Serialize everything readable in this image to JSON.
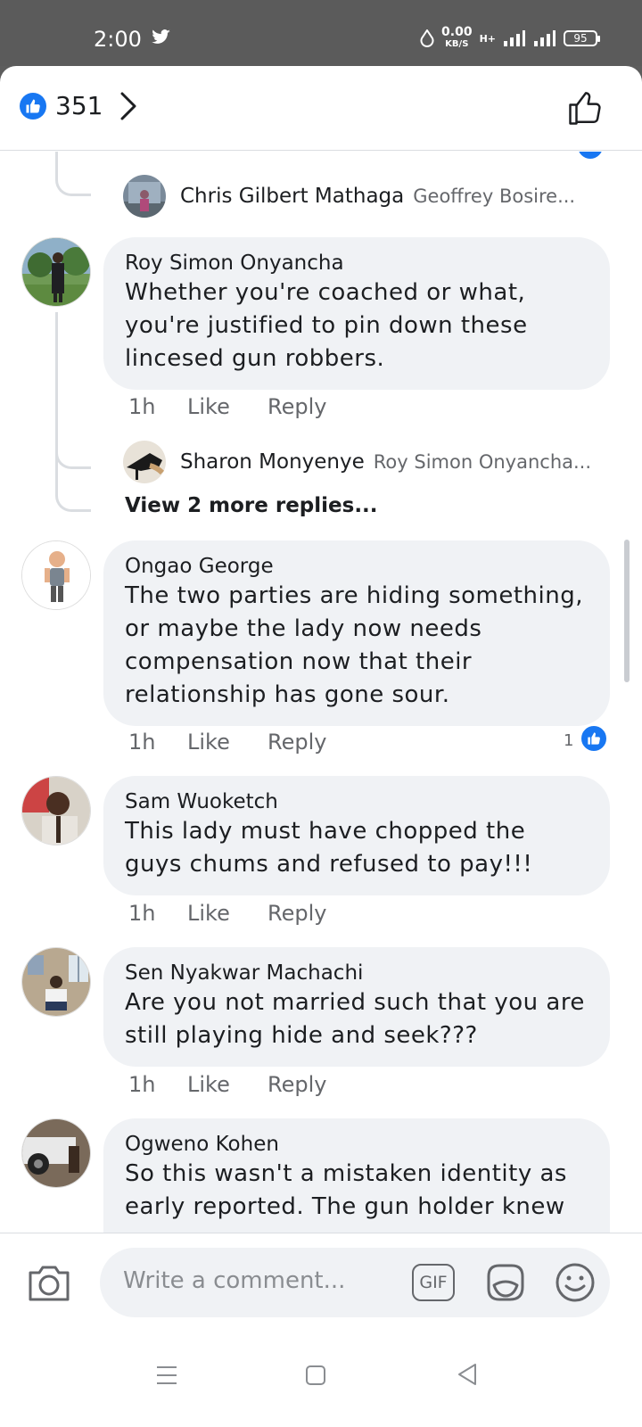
{
  "status_bar": {
    "time": "2:00",
    "speed_value": "0.00",
    "speed_unit": "KB/S",
    "network": "H+",
    "battery": "95"
  },
  "header": {
    "reaction_count": "351"
  },
  "comments": [
    {
      "author": "Roy Simon Onyancha",
      "text": "Whether you're coached or what, you're justified to pin down these lincesed gun robbers.",
      "time": "1h",
      "like": "Like",
      "reply": "Reply"
    },
    {
      "author": "Ongao George",
      "text": "The two parties are hiding something, or maybe the lady now needs compensation now that their relationship has gone sour.",
      "time": "1h",
      "like": "Like",
      "reply": "Reply",
      "reactions": "1"
    },
    {
      "author": "Sam Wuoketch",
      "text": "This lady must have chopped the guys chums and refused to pay!!!",
      "time": "1h",
      "like": "Like",
      "reply": "Reply"
    },
    {
      "author": "Sen Nyakwar Machachi",
      "text": "Are you not married such that you are still playing hide and seek???",
      "time": "1h",
      "like": "Like",
      "reply": "Reply"
    },
    {
      "author": "Ogweno Kohen",
      "text": "So this wasn't a mistaken identity as early reported. The gun holder knew"
    }
  ],
  "replies": [
    {
      "author": "Chris Gilbert Mathaga",
      "preview": "Geoffrey Bosire..."
    },
    {
      "author": "Sharon Monyenye",
      "preview": "Roy Simon Onyancha..."
    }
  ],
  "view_more": "View 2 more replies...",
  "composer": {
    "placeholder": "Write a comment...",
    "gif_label": "GIF"
  },
  "colors": {
    "accent": "#1877f2",
    "bubble": "#f0f2f5",
    "muted": "#65676b"
  }
}
